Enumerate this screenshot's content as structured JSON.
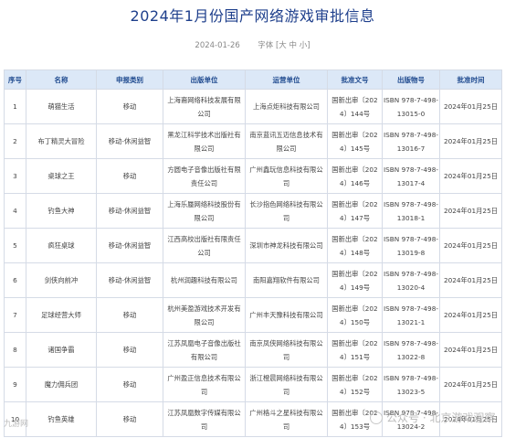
{
  "title": "2024年1月份国产网络游戏审批信息",
  "meta": {
    "date": "2024-01-26",
    "font_label": "字体",
    "font_big": "大",
    "font_mid": "中",
    "font_small": "小"
  },
  "table": {
    "headers": [
      "序号",
      "名称",
      "申报类别",
      "出版单位",
      "运营单位",
      "批准文号",
      "出版物号",
      "批准时间"
    ],
    "rows": [
      [
        "1",
        "萌猫生活",
        "移动",
        "上海裔网络科技发展有限公司",
        "上海点炬科技有限公司",
        "国新出审〔2024〕144号",
        "ISBN 978-7-498-13015-0",
        "2024年01月25日"
      ],
      [
        "2",
        "布丁精灵大冒险",
        "移动-休闲益智",
        "黑龙江科学技术出版社有限公司",
        "南京蓝讯五迈信息技术有限公司",
        "国新出审〔2024〕145号",
        "ISBN 978-7-498-13016-7",
        "2024年01月25日"
      ],
      [
        "3",
        "桌球之王",
        "移动",
        "方圆电子音像出版社有限责任公司",
        "广州鑫玩信息科技有限公司",
        "国新出审〔2024〕146号",
        "ISBN 978-7-498-13017-4",
        "2024年01月25日"
      ],
      [
        "4",
        "钓鱼大神",
        "移动-休闲益智",
        "上海乐蜃网络科技股份有限公司",
        "长沙指色网络科技有限公司",
        "国新出审〔2024〕147号",
        "ISBN 978-7-498-13018-1",
        "2024年01月25日"
      ],
      [
        "5",
        "疯狂桌球",
        "移动-休闲益智",
        "江西高校出版社有限责任公司",
        "深圳市神龙科技有限公司",
        "国新出审〔2024〕148号",
        "ISBN 978-7-498-13019-8",
        "2024年01月25日"
      ],
      [
        "6",
        "剑侠向前冲",
        "移动-休闲益智",
        "杭州润趣科技有限公司",
        "南阳嘉翔软件有限公司",
        "国新出审〔2024〕149号",
        "ISBN 978-7-498-13020-4",
        "2024年01月25日"
      ],
      [
        "7",
        "足球经营大师",
        "移动",
        "杭州美盈游戏技术开发有限公司",
        "广州丰天豫科技有限公司",
        "国新出审〔2024〕150号",
        "ISBN 978-7-498-13021-1",
        "2024年01月25日"
      ],
      [
        "8",
        "诸国争霸",
        "移动",
        "江苏凤凰电子音像出版社有限公司",
        "南京凤侠网络科技有限公司",
        "国新出审〔2024〕151号",
        "ISBN 978-7-498-13022-8",
        "2024年01月25日"
      ],
      [
        "9",
        "魔力佣兵团",
        "移动",
        "广州盈正信息技术有限公司",
        "浙江橙晨网络科技有限公司",
        "国新出审〔2024〕152号",
        "ISBN 978-7-498-13023-5",
        "2024年01月25日"
      ],
      [
        "10",
        "钓鱼英雄",
        "移动",
        "江苏凤凰数字传媒有限公司",
        "广州格斗之星科技有限公司",
        "国新出审〔2024〕153号",
        "ISBN 978-7-498-13024-2",
        "2024年01月25日"
      ]
    ]
  },
  "watermarks": {
    "left": "九游网",
    "right": "公众号 · 北京游戏观察"
  }
}
